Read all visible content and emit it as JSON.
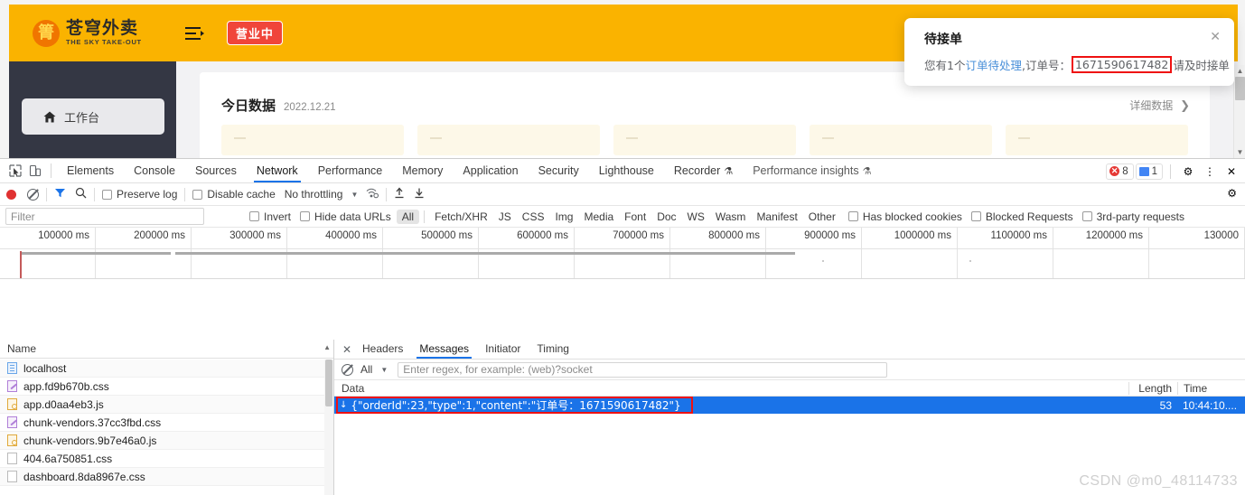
{
  "app": {
    "logo": {
      "cn": "苍穹外卖",
      "en": "THE SKY TAKE-OUT",
      "mark": "箐"
    },
    "status_badge": "营业中",
    "sidebar": {
      "items": [
        {
          "label": "工作台",
          "icon": "home-icon"
        }
      ]
    },
    "dashboard": {
      "title": "今日数据",
      "date": "2022.12.21",
      "detail_link": "详细数据",
      "detail_chevron": "❯"
    }
  },
  "notification": {
    "title": "待接单",
    "close": "✕",
    "message_prefix": "您有1个",
    "message_link": "订单待处理",
    "message_mid": ",订单号：",
    "order_id": "1671590617482",
    "message_suffix": "请及时接单"
  },
  "devtools": {
    "icons": {
      "inspect": "inspect-element-icon",
      "device": "device-toolbar-icon"
    },
    "tabs": [
      {
        "label": "Elements",
        "active": false
      },
      {
        "label": "Console",
        "active": false
      },
      {
        "label": "Sources",
        "active": false
      },
      {
        "label": "Network",
        "active": true
      },
      {
        "label": "Performance",
        "active": false
      },
      {
        "label": "Memory",
        "active": false
      },
      {
        "label": "Application",
        "active": false
      },
      {
        "label": "Security",
        "active": false
      },
      {
        "label": "Lighthouse",
        "active": false
      },
      {
        "label": "Recorder",
        "active": false,
        "flask": true
      },
      {
        "label": "Performance insights",
        "active": false,
        "flask": true
      }
    ],
    "badges": {
      "errors": "8",
      "messages": "1"
    },
    "header_actions": {
      "settings": "⚙",
      "more": "⋮",
      "close": "✕"
    },
    "toolbar": {
      "record": "record-button",
      "clear": "clear-button",
      "filter_toggle": "filter-icon",
      "search": "search-icon",
      "preserve_log": "Preserve log",
      "disable_cache": "Disable cache",
      "throttling": "No throttling",
      "import": "import-har-icon",
      "export": "export-har-icon",
      "settings": "⚙"
    },
    "filterbar": {
      "filter_placeholder": "Filter",
      "invert": "Invert",
      "hide_data_urls": "Hide data URLs",
      "types": [
        "All",
        "Fetch/XHR",
        "JS",
        "CSS",
        "Img",
        "Media",
        "Font",
        "Doc",
        "WS",
        "Wasm",
        "Manifest",
        "Other"
      ],
      "selected_type": "All",
      "has_blocked_cookies": "Has blocked cookies",
      "blocked_requests": "Blocked Requests",
      "third_party": "3rd-party requests"
    },
    "timeline": {
      "ticks": [
        "100000 ms",
        "200000 ms",
        "300000 ms",
        "400000 ms",
        "500000 ms",
        "600000 ms",
        "700000 ms",
        "800000 ms",
        "900000 ms",
        "1000000 ms",
        "1100000 ms",
        "1200000 ms",
        "130000"
      ]
    },
    "requests": {
      "column_header": "Name",
      "rows": [
        {
          "name": "localhost",
          "type": "doc"
        },
        {
          "name": "app.fd9b670b.css",
          "type": "css"
        },
        {
          "name": "app.d0aa4eb3.js",
          "type": "js"
        },
        {
          "name": "chunk-vendors.37cc3fbd.css",
          "type": "css"
        },
        {
          "name": "chunk-vendors.9b7e46a0.js",
          "type": "js"
        },
        {
          "name": "404.6a750851.css",
          "type": "plain"
        },
        {
          "name": "dashboard.8da8967e.css",
          "type": "plain"
        }
      ]
    },
    "details": {
      "tabs": [
        {
          "label": "Headers",
          "active": false
        },
        {
          "label": "Messages",
          "active": true
        },
        {
          "label": "Initiator",
          "active": false
        },
        {
          "label": "Timing",
          "active": false
        }
      ],
      "messages_toolbar": {
        "clear": "clear-icon",
        "all_label": "All",
        "regex_placeholder": "Enter regex, for example: (web)?socket"
      },
      "columns": {
        "data": "Data",
        "length": "Length",
        "time": "Time"
      },
      "rows": [
        {
          "direction": "↓",
          "data": "{\"orderId\":23,\"type\":1,\"content\":\"订单号：1671590617482\"}",
          "length": "53",
          "time": "10:44:10...."
        }
      ]
    }
  },
  "watermark": "CSDN @m0_48114733"
}
